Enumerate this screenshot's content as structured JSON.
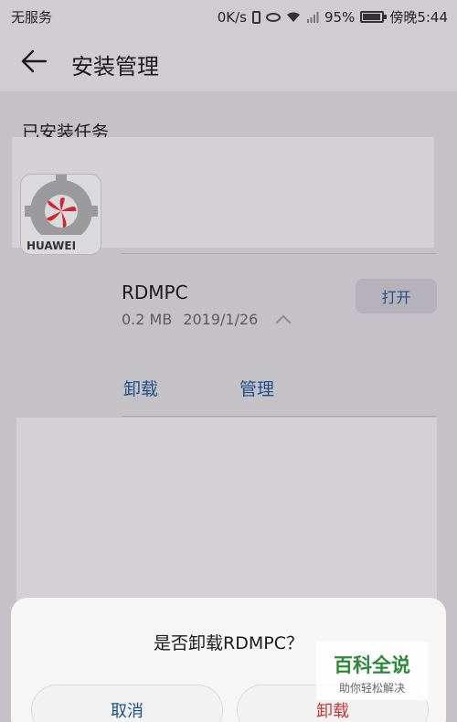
{
  "status_bar": {
    "carrier": "无服务",
    "speed": "0K/s",
    "battery": "95%",
    "time": "傍晚5:44",
    "icons": [
      "vibrate-icon",
      "eye-comfort-icon",
      "wifi-icon",
      "signal-icon",
      "battery-icon"
    ]
  },
  "app_bar": {
    "back_icon": "back-arrow-icon",
    "title": "安装管理"
  },
  "section": {
    "title": "已安装任务"
  },
  "app_item": {
    "name": "RDMPC",
    "size": "0.2 MB",
    "date": "2019/1/26",
    "icon_text": "HUAWEI",
    "open_label": "打开",
    "uninstall_label": "卸载",
    "manage_label": "管理"
  },
  "dialog": {
    "message": "是否卸载RDMPC？",
    "cancel_label": "取消",
    "confirm_label": "卸载"
  },
  "watermark": {
    "main": "百科全说",
    "sub": "助你轻松解决"
  },
  "colors": {
    "accent": "#1e4f88",
    "danger": "#c0393b",
    "dim_background": "#c4c2c6",
    "dialog_background": "#f6f6f6",
    "watermark_green": "#2b8a3a"
  }
}
